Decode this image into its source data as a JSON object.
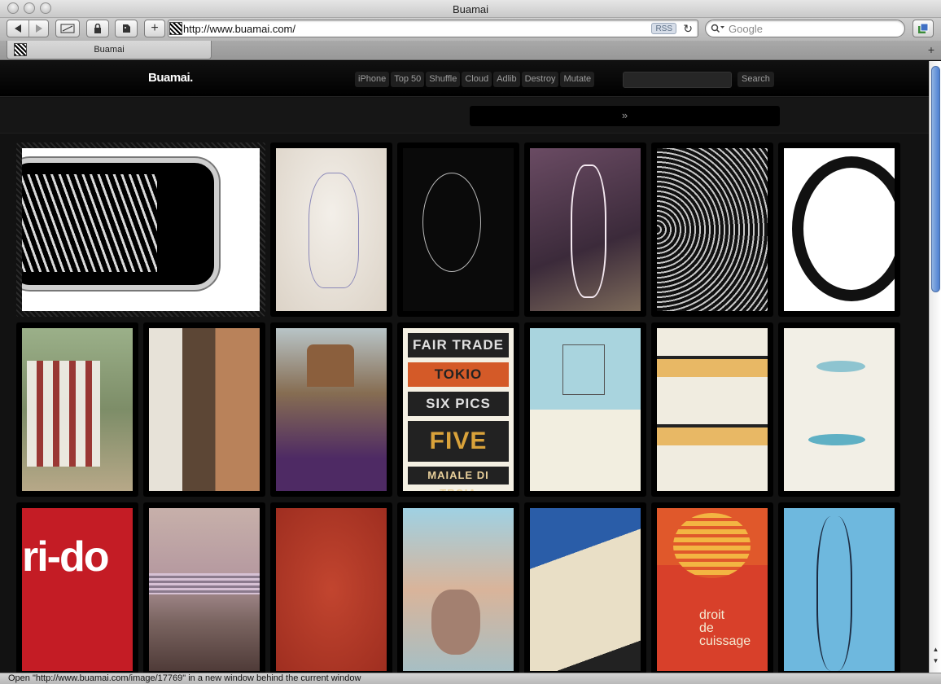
{
  "window": {
    "title": "Buamai"
  },
  "toolbar": {
    "url": "http://www.buamai.com/",
    "rss_label": "RSS",
    "search_placeholder": "Google"
  },
  "tab": {
    "label": "Buamai"
  },
  "site": {
    "logo": "Buamai.",
    "nav": [
      "iPhone",
      "Top 50",
      "Shuffle",
      "Cloud",
      "Adlib",
      "Destroy",
      "Mutate"
    ],
    "search_button": "Search",
    "pager_label": "»"
  },
  "thumbnails": {
    "poster_lines": [
      "FAIR TRADE",
      "TOKIO",
      "SIX PICS",
      "FIVE",
      "MAIALE DI TROIA"
    ],
    "ridoc_text": "ri-do",
    "droit_text": [
      "droit",
      "de",
      "cuissage"
    ]
  },
  "status": {
    "text": "Open \"http://www.buamai.com/image/17769\" in a new window behind the current window"
  }
}
